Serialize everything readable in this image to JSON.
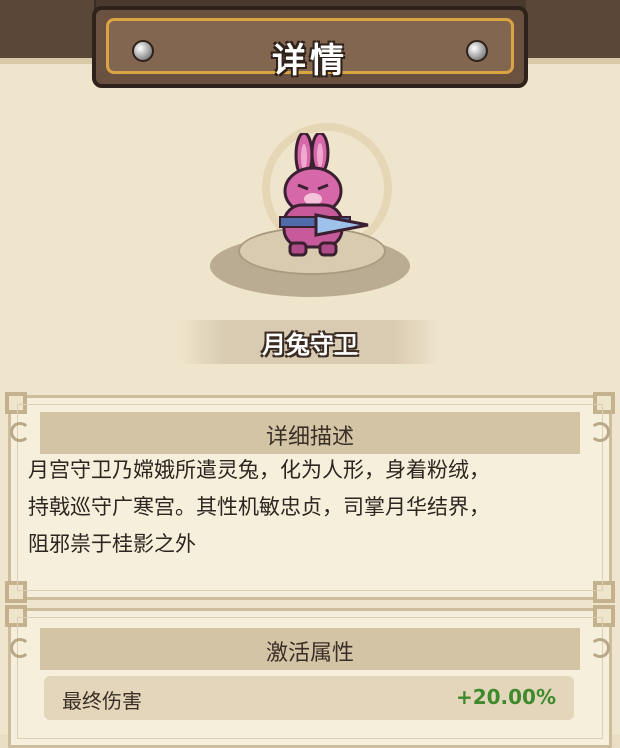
{
  "title": "详情",
  "character": {
    "name": "月兔守卫",
    "image_icon": "pink-rabbit-guard-icon"
  },
  "description_section": {
    "header": "详细描述",
    "lines": [
      "月宫守卫乃嫦娥所遣灵兔，化为人形，身着粉绒，",
      "持戟巡守广寒宫。其性机敏忠贞，司掌月华结界，",
      "阻邪祟于桂影之外"
    ]
  },
  "attributes_section": {
    "header": "激活属性",
    "items": [
      {
        "name": "最终伤害",
        "value": "+20.00%"
      }
    ]
  },
  "colors": {
    "value_positive": "#3f8a2c",
    "banner_border": "#d9a441",
    "rabbit_pink": "#d667a8"
  }
}
